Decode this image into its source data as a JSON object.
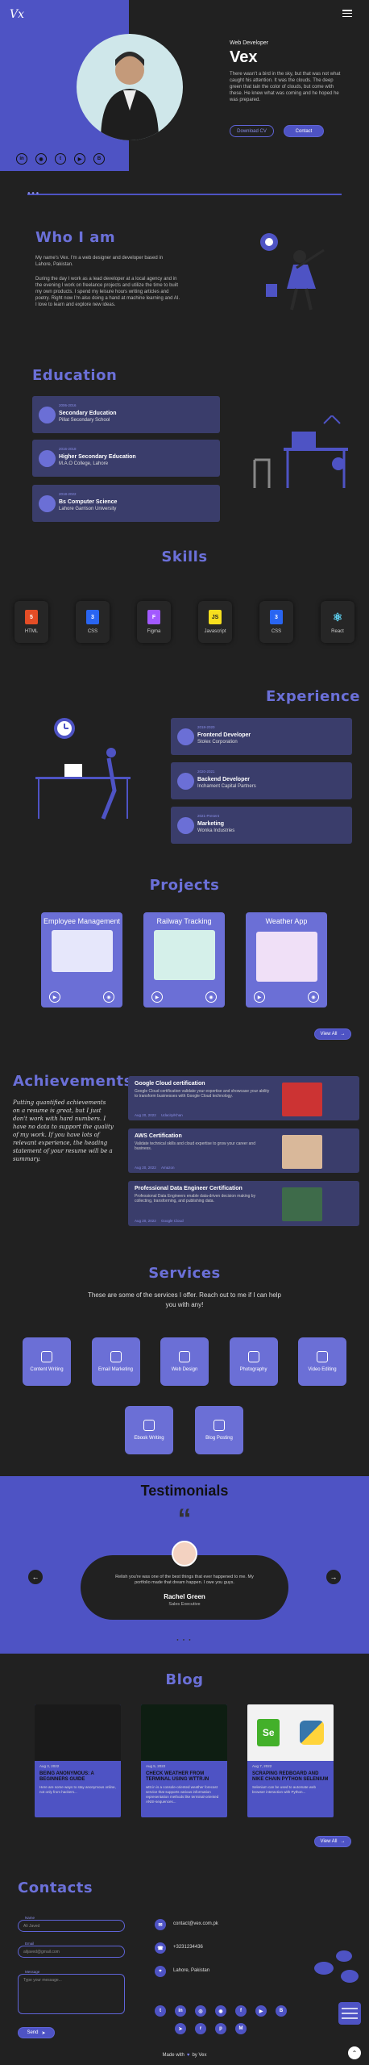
{
  "hero": {
    "logo": "Vx",
    "role": "Web Developer",
    "name": "Vex",
    "bio": "There wasn't a bird in the sky, but that was not what caught his attention. It was the clouds. The deep green that tain the color of clouds, but come with these. He knew what was coming and he hoped he was prepared.",
    "download_cv": "Download CV",
    "contact": "Contact"
  },
  "about": {
    "title": "Who I am",
    "p1": "My name's Vex. I'm a web designer and developer based in Lahore, Pakistan.",
    "p2": "During the day I work as a lead developer at a local agency and in the evening I work on freelance projects and utilize the time to built my own products. I spend my leisure hours writing articles and poetry. Right now I'm also doing a hand at machine learning and AI. I love to learn and explore new ideas."
  },
  "education": {
    "title": "Education",
    "items": [
      {
        "date": "2006-2016",
        "degree": "Secondary Education",
        "school": "Pillat Secondary School"
      },
      {
        "date": "2016-2018",
        "degree": "Higher Secondary Education",
        "school": "M.A.O College, Lahore"
      },
      {
        "date": "2018-2022",
        "degree": "Bs Computer Science",
        "school": "Lahore Garrison University"
      }
    ]
  },
  "skills": {
    "title": "Skills",
    "items": [
      {
        "label": "HTML",
        "icon": "html5-icon",
        "color": "#e44d26",
        "glyph": "5"
      },
      {
        "label": "CSS",
        "icon": "css3-icon",
        "color": "#2965f1",
        "glyph": "3"
      },
      {
        "label": "Figma",
        "icon": "figma-icon",
        "color": "#a259ff",
        "glyph": "F"
      },
      {
        "label": "Javascript",
        "icon": "javascript-icon",
        "color": "#f7df1e",
        "glyph": "JS"
      },
      {
        "label": "CSS",
        "icon": "css3-icon",
        "color": "#2965f1",
        "glyph": "3"
      },
      {
        "label": "React",
        "icon": "react-icon",
        "color": "#61dafb",
        "glyph": "⚛"
      }
    ]
  },
  "experience": {
    "title": "Experience",
    "items": [
      {
        "date": "2018-2020",
        "role": "Frontend Developer",
        "company": "Stolex Corporation"
      },
      {
        "date": "2020-2021",
        "role": "Backend Developer",
        "company": "Inchament Capital Partners"
      },
      {
        "date": "2021-Present",
        "role": "Marketing",
        "company": "Wonka Industries"
      }
    ]
  },
  "projects": {
    "title": "Projects",
    "items": [
      {
        "title": "Employee Management"
      },
      {
        "title": "Railway Tracking"
      },
      {
        "title": "Weather App"
      }
    ],
    "view_all": "View All"
  },
  "achievements": {
    "title": "Achievements",
    "quote": "Putting quantified achievements on a resume is great, but I just don't work with hard numbers. I have no data to support the quality of my work. If you have lots of relevant experience, the heading statement of your resume will be a summary.",
    "items": [
      {
        "title": "Google Cloud certification",
        "desc": "Google Cloud certification validate your expertise and showcase your ability to transform businesses with Google Cloud technology.",
        "date": "Aug 20, 2022",
        "org": "Udacity/Khan"
      },
      {
        "title": "AWS Certification",
        "desc": "Validate technical skills and cloud expertise to grow your career and business.",
        "date": "Aug 20, 2022",
        "org": "Amazon"
      },
      {
        "title": "Professional Data Engineer Certification",
        "desc": "Professional Data Engineers enable data-driven decision making by collecting, transforming, and publishing data.",
        "date": "Aug 20, 2022",
        "org": "Google Cloud"
      }
    ]
  },
  "services": {
    "title": "Services",
    "subtitle": "These are some of the services I offer. Reach out to me if I can help you with any!",
    "items": [
      {
        "label": "Content Writing",
        "icon": "pen-icon"
      },
      {
        "label": "Email Marketing",
        "icon": "mail-icon"
      },
      {
        "label": "Web Design",
        "icon": "code-icon"
      },
      {
        "label": "Photography",
        "icon": "camera-icon"
      },
      {
        "label": "Video Editing",
        "icon": "video-icon"
      },
      {
        "label": "Ebook Writing",
        "icon": "book-icon"
      },
      {
        "label": "Blog Posting",
        "icon": "blog-icon"
      }
    ]
  },
  "testimonials": {
    "title": "Testimonials",
    "quote": "Relish you're was one of the best things that ever happened to me. My portfolio made that dream happen. I owe you guys.",
    "name": "Rachel Green",
    "role": "Sales Executive"
  },
  "blog": {
    "title": "Blog",
    "items": [
      {
        "date": "Aug 3, 2022",
        "title": "BEING ANONYMOUS: A BEGINNERS GUIDE",
        "desc": "Here are some ways to stay anonymous online, not only from hackers..."
      },
      {
        "date": "Aug 5, 2022",
        "title": "CHECK WEATHER FROM TERMINAL USING WTTR.IN",
        "desc": "wttr.in is a console-oriented weather forecast service that supports various information representation methods like terminal-oriented ANSI-sequences..."
      },
      {
        "date": "Aug 7, 2022",
        "title": "SCRAPING REDBOARD AND NIKE CHAIN PYTHON SELENIUM",
        "desc": "Selenium can be used to automate web browser interaction with Python..."
      }
    ],
    "view_all": "View All"
  },
  "contacts": {
    "title": "Contacts",
    "name_placeholder": "Ali Javed",
    "email_placeholder": "alijaved@gmail.com",
    "message_placeholder": "Type your message...",
    "name_label": "Name",
    "email_label": "Email",
    "message_label": "Message",
    "send": "Send",
    "email": "contact@vex.com.pk",
    "phone": "+3231234436",
    "location": "Lahore, Pakistan"
  },
  "footer": {
    "made_with": "Made with",
    "by": "by Vex"
  }
}
